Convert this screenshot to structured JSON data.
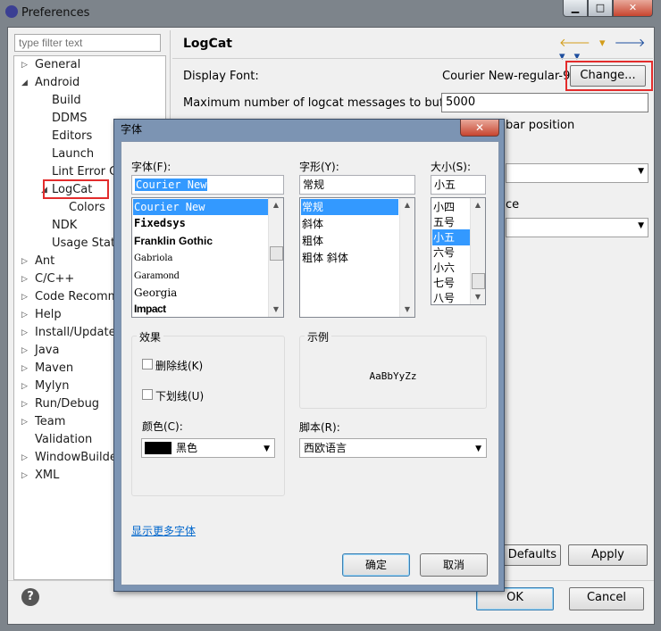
{
  "window": {
    "title": "Preferences",
    "min_glyph": "▁",
    "max_glyph": "□",
    "close_glyph": "✕"
  },
  "sidebar": {
    "filter_placeholder": "type filter text",
    "items": [
      {
        "label": "General",
        "twisty": "▷"
      },
      {
        "label": "Android",
        "twisty": "◢"
      },
      {
        "label": "Build"
      },
      {
        "label": "DDMS"
      },
      {
        "label": "Editors"
      },
      {
        "label": "Launch"
      },
      {
        "label": "Lint Error Ch"
      },
      {
        "label": "LogCat",
        "twisty": "◢"
      },
      {
        "label": "Colors"
      },
      {
        "label": "NDK"
      },
      {
        "label": "Usage Stats"
      },
      {
        "label": "Ant",
        "twisty": "▷"
      },
      {
        "label": "C/C++",
        "twisty": "▷"
      },
      {
        "label": "Code Recomme",
        "twisty": "▷"
      },
      {
        "label": "Help",
        "twisty": "▷"
      },
      {
        "label": "Install/Update",
        "twisty": "▷"
      },
      {
        "label": "Java",
        "twisty": "▷"
      },
      {
        "label": "Maven",
        "twisty": "▷"
      },
      {
        "label": "Mylyn",
        "twisty": "▷"
      },
      {
        "label": "Run/Debug",
        "twisty": "▷"
      },
      {
        "label": "Team",
        "twisty": "▷"
      },
      {
        "label": "Validation"
      },
      {
        "label": "WindowBuilder",
        "twisty": "▷"
      },
      {
        "label": "XML",
        "twisty": "▷"
      }
    ]
  },
  "page": {
    "title": "LogCat",
    "nav_back": "🡐 ▾",
    "nav_forward": "🡒 ▾ ▾",
    "display_font_label": "Display Font:",
    "display_font_value": "Courier New-regular-9",
    "change_button": "Change...",
    "max_messages_label": "Maximum number of logcat messages to buffer:",
    "max_messages_value": "5000",
    "partial_text_1": "bar position",
    "partial_text_2": "ce",
    "restore_defaults_fragment": "e Defaults",
    "apply_button": "Apply",
    "ok_button": "OK",
    "cancel_button": "Cancel",
    "help_glyph": "?"
  },
  "font_dialog": {
    "title": "字体",
    "close_glyph": "✕",
    "font_label": "字体(F):",
    "font_value": "Courier New",
    "fonts": [
      "Courier New",
      "Fixedsys",
      "Franklin Gothic",
      "Gabriola",
      "Garamond",
      "Georgia",
      "Impact"
    ],
    "style_label": "字形(Y):",
    "style_value": "常规",
    "styles": [
      "常规",
      "斜体",
      "粗体",
      "粗体 斜体"
    ],
    "size_label": "大小(S):",
    "size_value": "小五",
    "sizes": [
      "小四",
      "五号",
      "小五",
      "六号",
      "小六",
      "七号",
      "八号"
    ],
    "effects_label": "效果",
    "strikeout_label": "删除线(K)",
    "underline_label": "下划线(U)",
    "color_label": "颜色(C):",
    "color_value": "黑色",
    "sample_label": "示例",
    "sample_text": "AaBbYyZz",
    "script_label": "脚本(R):",
    "script_value": "西欧语言",
    "more_fonts_link": "显示更多字体",
    "ok_button": "确定",
    "cancel_button": "取消"
  },
  "colors": {
    "selection": "#3399ff",
    "highlight_box": "#e32c2c",
    "color_swatch": "#000000"
  }
}
